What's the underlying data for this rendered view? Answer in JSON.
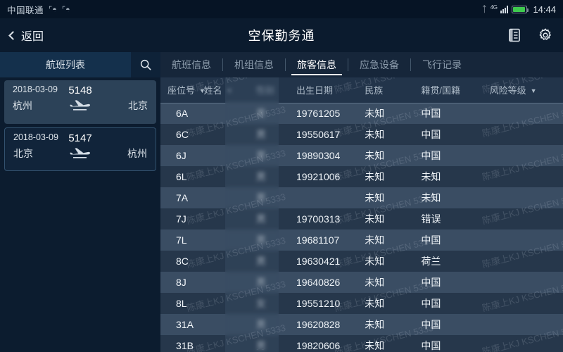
{
  "status_bar": {
    "carrier": "中国联通",
    "usb_icons": [
      "usb-icon",
      "usb-icon"
    ],
    "bluetooth_icon": "bluetooth-icon",
    "network_label": "4G",
    "signal_icon": "signal-bars-icon",
    "battery_icon": "battery-icon",
    "battery_color": "#3ec94e",
    "time": "14:44"
  },
  "header": {
    "back_label": "返回",
    "back_icon": "chevron-left-icon",
    "title": "空保勤务通",
    "actions": [
      {
        "name": "document-icon",
        "label": "文档"
      },
      {
        "name": "gear-icon",
        "label": "设置"
      }
    ]
  },
  "sidebar": {
    "title": "航班列表",
    "search_icon": "search-icon",
    "flights": [
      {
        "date": "2018-03-09",
        "flight_no": "5148",
        "origin": "杭州",
        "destination": "北京",
        "plane_icon": "airplane-icon",
        "selected": true
      },
      {
        "date": "2018-03-09",
        "flight_no": "5147",
        "origin": "北京",
        "destination": "杭州",
        "plane_icon": "airplane-icon",
        "selected": false
      }
    ]
  },
  "tabs": [
    {
      "label": "航班信息",
      "active": false
    },
    {
      "label": "机组信息",
      "active": false
    },
    {
      "label": "旅客信息",
      "active": true
    },
    {
      "label": "应急设备",
      "active": false
    },
    {
      "label": "飞行记录",
      "active": false
    }
  ],
  "passenger_table": {
    "columns": [
      {
        "label": "座位号",
        "sortable": true,
        "width": "9%"
      },
      {
        "label": "姓名",
        "sortable": true,
        "width": "13%"
      },
      {
        "label": "性别",
        "sortable": false,
        "width": "10%"
      },
      {
        "label": "出生日期",
        "sortable": false,
        "width": "17%"
      },
      {
        "label": "民族",
        "sortable": false,
        "width": "14%"
      },
      {
        "label": "籍贯/国籍",
        "sortable": false,
        "width": "17%"
      },
      {
        "label": "风险等级",
        "sortable": true,
        "width": "20%"
      }
    ],
    "sort_caret": "▼",
    "rows": [
      {
        "seat": "6A",
        "name": "",
        "gender": "男",
        "birth": "19761205",
        "ethnicity": "未知",
        "nationality": "中国",
        "risk": ""
      },
      {
        "seat": "6C",
        "name": "",
        "gender": "男",
        "birth": "19550617",
        "ethnicity": "未知",
        "nationality": "中国",
        "risk": ""
      },
      {
        "seat": "6J",
        "name": "",
        "gender": "男",
        "birth": "19890304",
        "ethnicity": "未知",
        "nationality": "中国",
        "risk": ""
      },
      {
        "seat": "6L",
        "name": "",
        "gender": "男",
        "birth": "19921006",
        "ethnicity": "未知",
        "nationality": "未知",
        "risk": ""
      },
      {
        "seat": "7A",
        "name": "",
        "gender": "男",
        "birth": "",
        "ethnicity": "未知",
        "nationality": "未知",
        "risk": ""
      },
      {
        "seat": "7J",
        "name": "",
        "gender": "男",
        "birth": "19700313",
        "ethnicity": "未知",
        "nationality": "错误",
        "risk": ""
      },
      {
        "seat": "7L",
        "name": "",
        "gender": "男",
        "birth": "19681107",
        "ethnicity": "未知",
        "nationality": "中国",
        "risk": ""
      },
      {
        "seat": "8C",
        "name": "",
        "gender": "男",
        "birth": "19630421",
        "ethnicity": "未知",
        "nationality": "荷兰",
        "risk": ""
      },
      {
        "seat": "8J",
        "name": "",
        "gender": "男",
        "birth": "19640826",
        "ethnicity": "未知",
        "nationality": "中国",
        "risk": ""
      },
      {
        "seat": "8L",
        "name": "",
        "gender": "女",
        "birth": "19551210",
        "ethnicity": "未知",
        "nationality": "中国",
        "risk": ""
      },
      {
        "seat": "31A",
        "name": "",
        "gender": "男",
        "birth": "19620828",
        "ethnicity": "未知",
        "nationality": "中国",
        "risk": ""
      },
      {
        "seat": "31B",
        "name": "",
        "gender": "男",
        "birth": "19820606",
        "ethnicity": "未知",
        "nationality": "中国",
        "risk": ""
      }
    ]
  },
  "watermark": {
    "text": "陈康上KJ KSCHEN 5333"
  },
  "colors": {
    "status_bar_bg": "#061425",
    "header_bg": "#0b1b2e",
    "sidebar_bg": "#0c1c2f",
    "main_bg": "#16263a",
    "row_odd": "#3a4d63",
    "row_even": "#26374b",
    "accent_text": "#ffffff",
    "muted_text": "#8c9cac"
  }
}
